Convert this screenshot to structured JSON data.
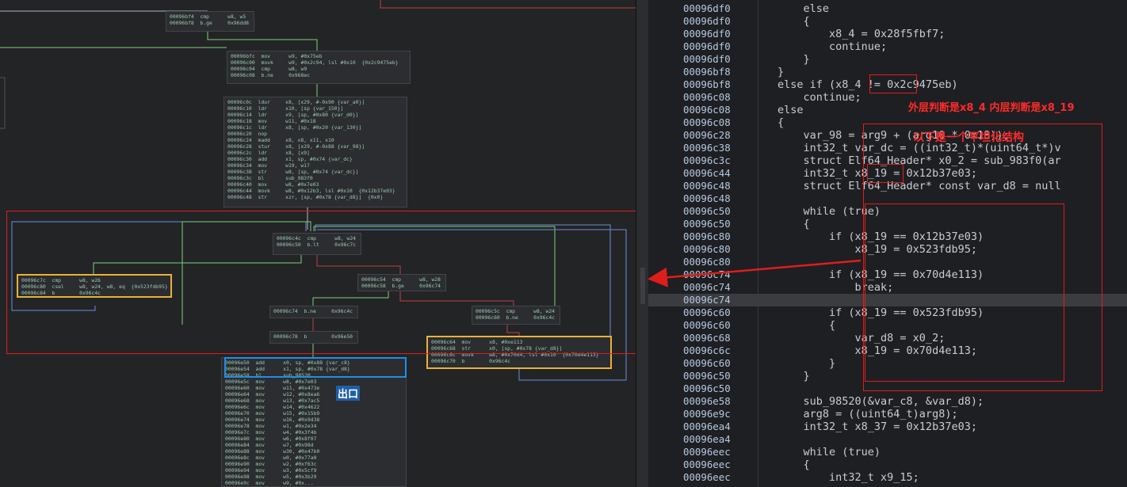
{
  "graph": {
    "blocks": [
      {
        "id": "b1",
        "lines": [
          "00096bf4  cmp      w8, w5",
          "00096bf8  b.ge     0x96dd8"
        ]
      },
      {
        "id": "b2",
        "lines": [
          "00096bfc  mov      w9, #0x75eb",
          "00096c00  movk     w9, #0x2c94, lsl #0x10  {0x2c9475eb}",
          "00096c04  cmp      w8, w9",
          "00096c08  b.ne     0x968ec"
        ]
      },
      {
        "id": "b3",
        "lines": [
          "00096c0c  ldur     x8, [x29, #-0x90 {var_a0}]",
          "00096c10  ldr      x10, [sp {var_150}]",
          "00096c14  ldr      x9, [sp, #0x80 {var_d0}]",
          "00096c18  mov      w11, #0x18",
          "00096c1c  ldr      x8, [sp, #0x20 {var_130}]",
          "00096c20  nop",
          "00096c24  madd     x8, x8, x11, x10",
          "00096c28  stur     x8, [x29, #-0x88 {var_98}]",
          "00096c2c  ldr      x8, [x9]",
          "00096c30  add      x1, sp, #0x74 {var_dc}",
          "00096c34  mov      w19, w17",
          "00096c38  str      w8, [sp, #0x74 {var_dc}]",
          "00096c3c  bl       sub_983f0",
          "00096c40  mov      w8, #0x7e03",
          "00096c44  movk     w8, #0x12b3, lsl #0x10  {0x12b37e03}",
          "00096c48  str      xzr, [sp, #0x78 {var_d8}]  {0x0}"
        ]
      },
      {
        "id": "b4",
        "lines": [
          "00096c4c  cmp      w8, w24",
          "00096c50  b.lt     0x96c7c"
        ]
      },
      {
        "id": "b5",
        "lines": [
          "00096c7c  cmp      w8, w26",
          "00096c80  csel     w8, w24, w8, eq  {0x523fdb95}",
          "00096c84  b        0x96c4c"
        ]
      },
      {
        "id": "b6",
        "lines": [
          "00096c54  cmp      w8, w28",
          "00096c58  b.ge     0x96c74"
        ]
      },
      {
        "id": "b7",
        "lines": [
          "00096c74  b.ne     0x96c4c"
        ]
      },
      {
        "id": "b8",
        "lines": [
          "00096c5c  cmp      w8, w24",
          "00096c60  b.ne     0x96c4c"
        ]
      },
      {
        "id": "b9",
        "lines": [
          "00096c78  b        0x96e50"
        ]
      },
      {
        "id": "b10",
        "lines": [
          "00096c64  mov      x8, #0xe113",
          "00096c68  str      x0, [sp, #0x78 {var_d8}]",
          "00096c6c  movk     w8, #0x70d4, lsl #0x10  {0x70d4e113}",
          "00096c70  b        0x96c4c"
        ]
      },
      {
        "id": "b11",
        "lines": [
          "00096e50  add      x0, sp, #0x88 {var_c8}",
          "00096e54  add      x1, sp, #0x78 {var_d8}",
          "00096e58  bl       sub_98520",
          "00096e5c  mov      w8, #0x7e03",
          "00096e60  mov      w11, #0x473e",
          "00096e64  mov      w12, #0x8ea6",
          "00096e68  mov      w13, #0x7ac5",
          "00096e6c  mov      w14, #0x4622",
          "00096e70  mov      w15, #0x15b9",
          "00096e74  mov      w16, #0x9d38",
          "00096e78  mov      w1, #0x2e34",
          "00096e7c  mov      w4, #0x3f4b",
          "00096e80  mov      w6, #0x8f07",
          "00096e84  mov      w7, #0x98d",
          "00096e88  mov      w30, #0x47b0",
          "00096e8c  mov      w0, #0x77a0",
          "00096e90  mov      w2, #0xf63c",
          "00096e94  mov      w3, #0x5cf9",
          "00096e98  mov      w5, #0x3b29",
          "00096e9c  mov      w9, #0x..."
        ]
      }
    ],
    "exit_label": "出口"
  },
  "decompiler": {
    "addresses": [
      "00096df0",
      "00096df0",
      "00096df0",
      "00096df0",
      "00096df0",
      "00096bf8",
      "00096bf8",
      "00096c08",
      "00096c08",
      "00096c08",
      "00096c28",
      "00096c38",
      "00096c3c",
      "00096c44",
      "00096c48",
      "00096c48",
      "00096c50",
      "00096c50",
      "00096c80",
      "00096c80",
      "00096c80",
      "00096c74",
      "00096c74",
      "00096c74",
      "00096c60",
      "00096c60",
      "00096c68",
      "00096c6c",
      "00096c60",
      "00096c50",
      "00096c50",
      "00096e58",
      "00096e9c",
      "00096ea4",
      "00096ea4",
      "00096eec",
      "00096eec",
      "00096eec"
    ],
    "lines": [
      "    else",
      "    {",
      "        x8_4 = 0x28f5fbf7;",
      "        continue;",
      "    }",
      "}",
      "else if (x8_4 != 0x2c9475eb)",
      "    continue;",
      "else",
      "{",
      "    var_98 = arg9 + (arg10 * 0x18));",
      "    int32_t var_dc = ((int32_t)*(uint64_t*)v",
      "    struct Elf64_Header* x0_2 = sub_983f0(ar",
      "    int32_t x8_19 = 0x12b37e03;",
      "    struct Elf64_Header* const var_d8 = null",
      "",
      "    while (true)",
      "    {",
      "        if (x8_19 == 0x12b37e03)",
      "            x8_19 = 0x523fdb95;",
      "",
      "        if (x8_19 == 0x70d4e113)",
      "            break;",
      "",
      "        if (x8_19 == 0x523fdb95)",
      "        {",
      "            var_d8 = x0_2;",
      "            x8_19 = 0x70d4e113;",
      "        }",
      "    }",
      "",
      "    sub_98520(&var_c8, &var_d8);",
      "    arg8 = ((uint64_t)arg8);",
      "    int32_t x8_37 = 0x12b37e03;",
      "",
      "    while (true)",
      "    {",
      "        int32_t x9_15;"
    ]
  },
  "annotations": {
    "note_outer_inner": "外层判断是x8_4 内层判断是x8_19",
    "note_flattening": "以下是一个平坦化结构"
  },
  "colors": {
    "annotation_red": "#e01d1d",
    "highlight_yellow": "#e8b13a",
    "highlight_blue": "#1e8fe8",
    "edge_green": "#7bd17b",
    "edge_red": "#c04040",
    "edge_blue": "#6a8fd8"
  }
}
